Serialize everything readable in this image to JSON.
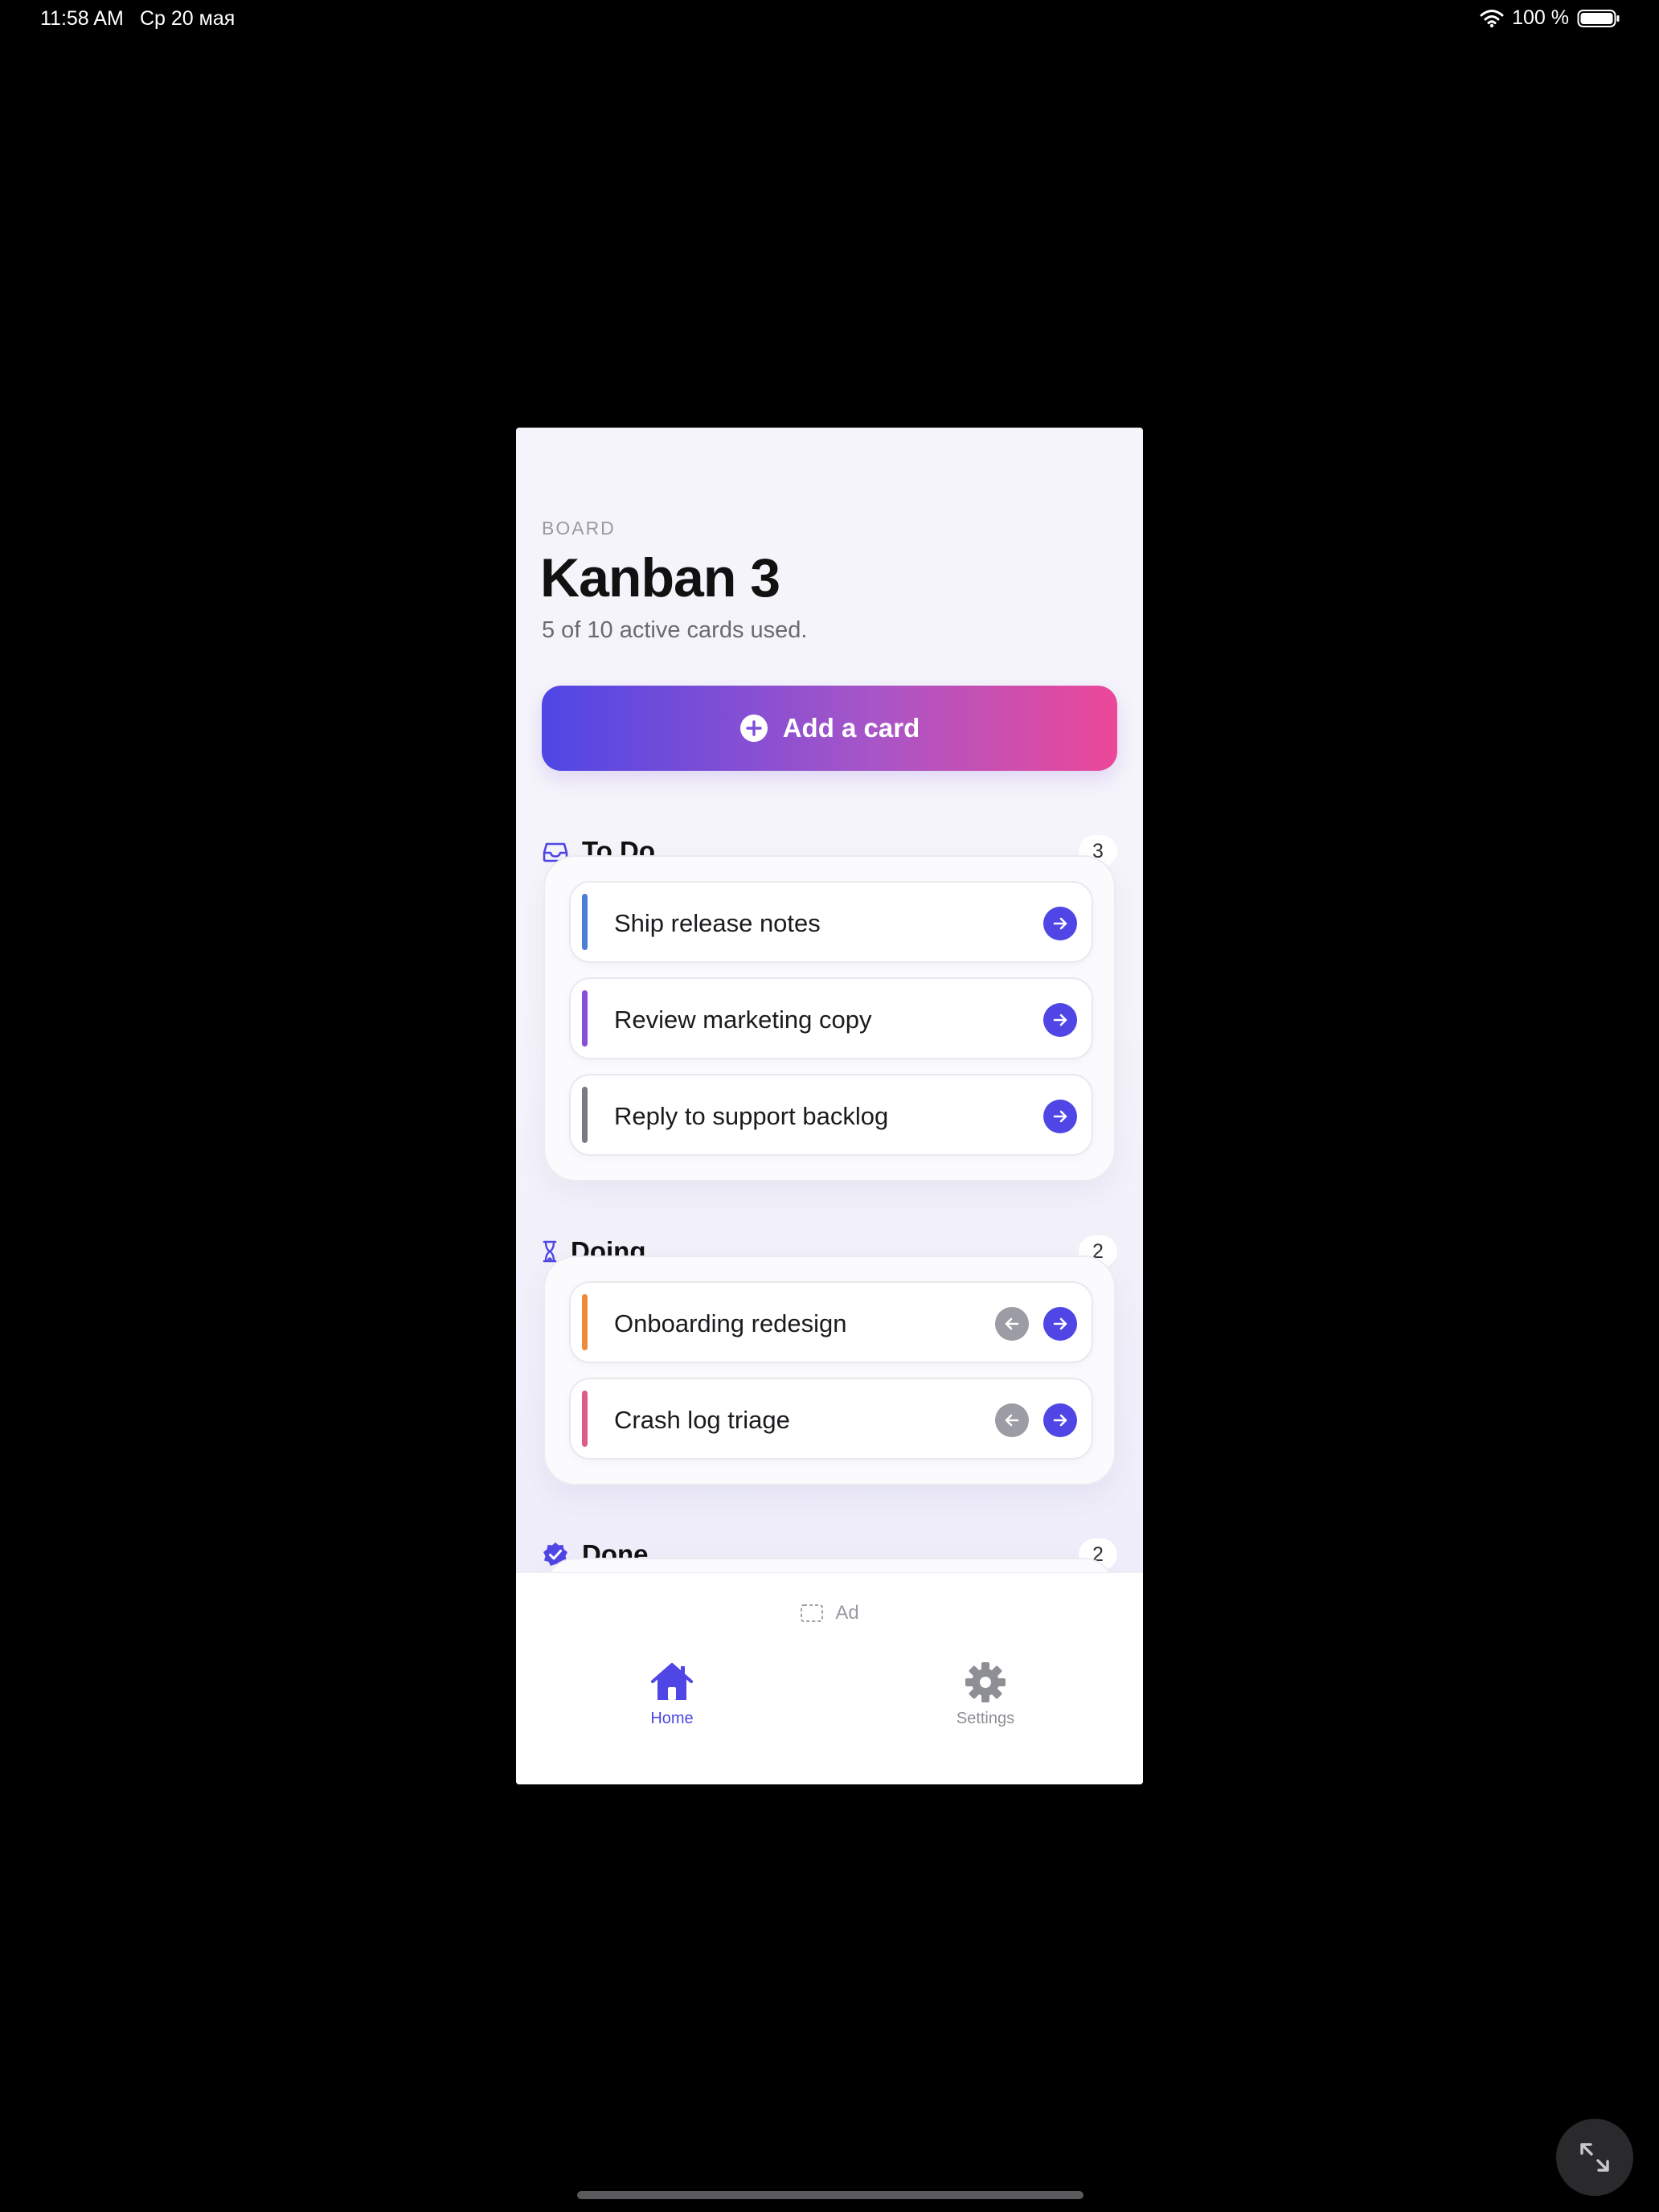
{
  "status_bar": {
    "time": "11:58 AM",
    "date": "Ср 20 мая",
    "battery": "100 %",
    "icons": [
      "wifi-icon",
      "battery-icon"
    ]
  },
  "header": {
    "eyebrow": "BOARD",
    "title": "Kanban 3",
    "subtitle": "5 of 10 active cards used."
  },
  "add_button": {
    "label": "Add a card",
    "icon": "plus-circle-icon"
  },
  "colors": {
    "accent": "#4f46e5",
    "gradient_start": "#4f46e5",
    "gradient_end": "#ec4899",
    "back_button": "#9b9ca4"
  },
  "columns": [
    {
      "name": "To Do",
      "count": "3",
      "icon": "inbox-tray-icon",
      "cards": [
        {
          "title": "Ship release notes",
          "color": "#4a7fd6",
          "actions": [
            "move-forward"
          ]
        },
        {
          "title": "Review marketing copy",
          "color": "#8a4fd8",
          "actions": [
            "move-forward"
          ]
        },
        {
          "title": "Reply to support backlog",
          "color": "#7a7a82",
          "actions": [
            "move-forward"
          ]
        }
      ]
    },
    {
      "name": "Doing",
      "count": "2",
      "icon": "hourglass-icon",
      "cards": [
        {
          "title": "Onboarding redesign",
          "color": "#ef8a3c",
          "actions": [
            "move-back",
            "move-forward"
          ]
        },
        {
          "title": "Crash log triage",
          "color": "#dc5d8a",
          "actions": [
            "move-back",
            "move-forward"
          ]
        }
      ]
    },
    {
      "name": "Done",
      "count": "2",
      "icon": "checkmark-seal-icon",
      "cards": []
    }
  ],
  "ad": {
    "label": "Ad",
    "icon": "ad-placeholder-icon"
  },
  "tab_bar": {
    "items": [
      {
        "label": "Home",
        "icon": "house-icon",
        "active": true
      },
      {
        "label": "Settings",
        "icon": "gear-icon",
        "active": false
      }
    ]
  },
  "overlay": {
    "expand_icon": "expand-arrows-icon"
  }
}
